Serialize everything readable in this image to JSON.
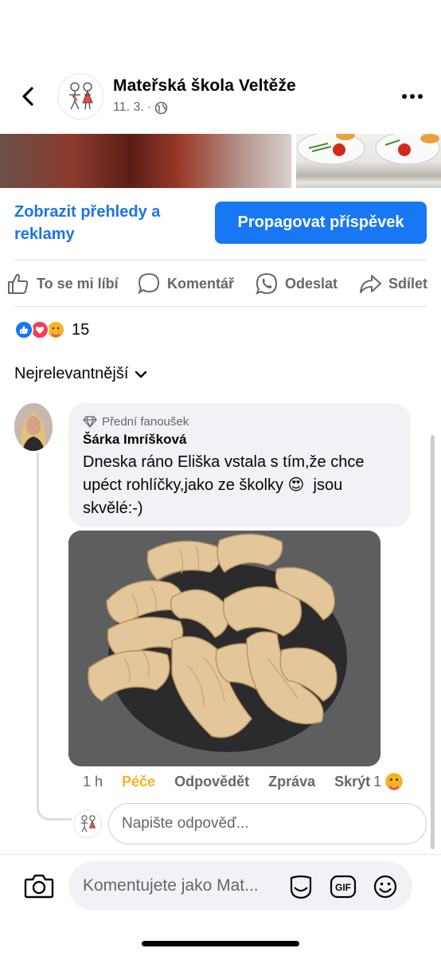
{
  "header": {
    "page_name": "Mateřská škola Veltěže",
    "date": "11. 3.",
    "separator": "·"
  },
  "post_actions": {
    "insights_link": "Zobrazit přehledy a reklamy",
    "boost_button": "Propagovat příspěvek"
  },
  "action_bar": {
    "like": "To se mi líbí",
    "comment": "Komentář",
    "send": "Odeslat",
    "share": "Sdílet"
  },
  "reactions": {
    "types": [
      "like",
      "love",
      "care"
    ],
    "count": "15"
  },
  "sort": {
    "label": "Nejrelevantnější"
  },
  "comment": {
    "badge": "Přední fanoušek",
    "author": "Šárka Imríšková",
    "text_part1": "Dneska ráno Eliška vstala s tím,že chce upéct rohlíčky,jako ze školky",
    "emoji": "😍",
    "text_part2": "jsou skvělé:-)",
    "time": "1 h",
    "reaction_label": "Péče",
    "reply": "Odpovědět",
    "message": "Zpráva",
    "hide": "Skrýt",
    "reaction_count": "1"
  },
  "reply_input": {
    "placeholder": "Napište odpověď..."
  },
  "composer": {
    "placeholder": "Komentujete jako Mat...",
    "gif_label": "GIF"
  },
  "colors": {
    "brand_blue": "#1877f2",
    "link_blue": "#1b74e4",
    "secondary_text": "#65676b",
    "care_yellow": "#f7b125",
    "bubble_bg": "#f0f2f5"
  }
}
